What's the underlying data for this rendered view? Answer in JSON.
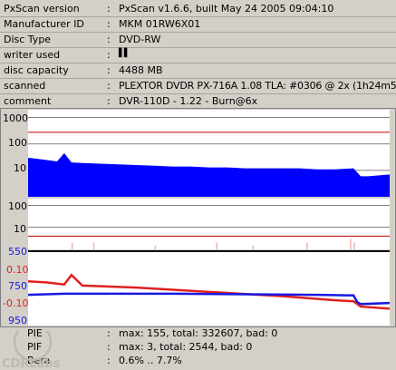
{
  "info": {
    "rows": [
      {
        "label": "PxScan version",
        "value": "PxScan v1.6.6, built May 24 2005 09:04:10"
      },
      {
        "label": "Manufacturer ID",
        "value": "MKM 01RW6X01"
      },
      {
        "label": "Disc Type",
        "value": "DVD-RW"
      },
      {
        "label": "writer used",
        "value": "▌▌"
      },
      {
        "label": "disc capacity",
        "value": "4488 MB"
      },
      {
        "label": "scanned",
        "value": "PLEXTOR DVDR PX-716A 1.08 TLA: #0306 @ 2x (1h24m51s)"
      },
      {
        "label": "comment",
        "value": "DVR-110D - 1.22 - Burn@6x"
      }
    ]
  },
  "colors": {
    "background": "#d4d0c8",
    "plot_bg": "#ffffff",
    "pie_fill": "#0000ff",
    "threshold_red": "#c00000",
    "jitter_red": "#e02020",
    "beta_blue": "#1818e0"
  },
  "chart_data": [
    {
      "type": "area",
      "name": "PIE",
      "scale": "log",
      "yticks": [
        "1000",
        "100",
        "10"
      ],
      "ylim": [
        1,
        2000
      ],
      "threshold": 280,
      "x": [
        0,
        0.02,
        0.05,
        0.08,
        0.1,
        0.12,
        0.15,
        0.2,
        0.25,
        0.3,
        0.35,
        0.4,
        0.45,
        0.5,
        0.55,
        0.6,
        0.65,
        0.7,
        0.75,
        0.8,
        0.85,
        0.9,
        0.92,
        0.94,
        1.0
      ],
      "values": [
        30,
        28,
        25,
        22,
        45,
        20,
        19,
        18,
        17,
        16,
        15,
        14,
        14,
        13,
        13,
        12,
        12,
        12,
        12,
        11,
        11,
        12,
        6,
        6,
        7
      ]
    },
    {
      "type": "area",
      "name": "PIF",
      "scale": "log",
      "yticks": [
        "100",
        "10"
      ],
      "ylim": [
        1,
        200
      ],
      "threshold": 4
    },
    {
      "type": "line",
      "name": "Jitter",
      "yticks_left": [
        "550",
        "750",
        "950"
      ],
      "yticks_right": [
        "0.10",
        "-0.10"
      ],
      "jitter": {
        "x": [
          0,
          0.05,
          0.1,
          0.12,
          0.15,
          0.3,
          0.5,
          0.7,
          0.85,
          0.9,
          0.92,
          1.0
        ],
        "values": [
          8.2,
          8.1,
          7.9,
          8.8,
          7.8,
          7.6,
          7.2,
          6.8,
          6.4,
          6.3,
          5.8,
          5.6
        ]
      },
      "beta": {
        "x": [
          0,
          0.1,
          0.2,
          0.4,
          0.6,
          0.8,
          0.9,
          0.91,
          0.92,
          1.0
        ],
        "values": [
          -0.05,
          -0.03,
          -0.03,
          -0.03,
          -0.04,
          -0.05,
          -0.06,
          -0.18,
          -0.22,
          -0.2
        ]
      }
    }
  ],
  "summary": {
    "rows": [
      {
        "label": "PIE",
        "value": "max: 155, total: 332607, bad: 0"
      },
      {
        "label": "PIF",
        "value": "max: 3, total: 2544, bad: 0"
      },
      {
        "label": "Beta",
        "value": "0.6% .. 7.7%"
      }
    ]
  },
  "watermark": "CDRLabs"
}
